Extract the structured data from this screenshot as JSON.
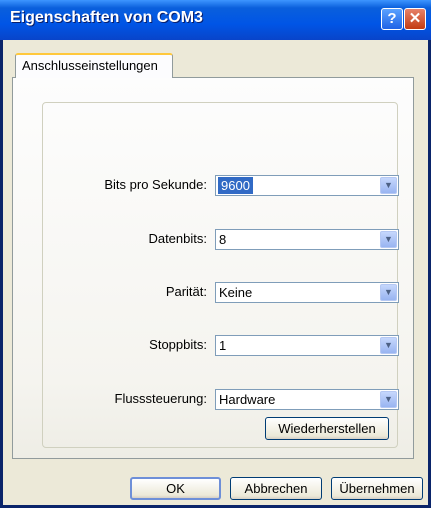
{
  "window": {
    "title": "Eigenschaften von COM3",
    "help_glyph": "?",
    "close_glyph": "✕"
  },
  "tab": {
    "label": "Anschlusseinstellungen"
  },
  "fields": [
    {
      "label": "Bits pro Sekunde:",
      "value": "9600",
      "selected": true
    },
    {
      "label": "Datenbits:",
      "value": "8"
    },
    {
      "label": "Parität:",
      "value": "Keine"
    },
    {
      "label": "Stoppbits:",
      "value": "1"
    },
    {
      "label": "Flusssteuerung:",
      "value": "Hardware"
    }
  ],
  "restore_button": "Wiederherstellen",
  "footer": {
    "ok": "OK",
    "cancel": "Abbrechen",
    "apply": "Übernehmen"
  },
  "icons": {
    "dropdown": "chevron-down-icon",
    "help": "help-icon",
    "close": "close-icon"
  }
}
